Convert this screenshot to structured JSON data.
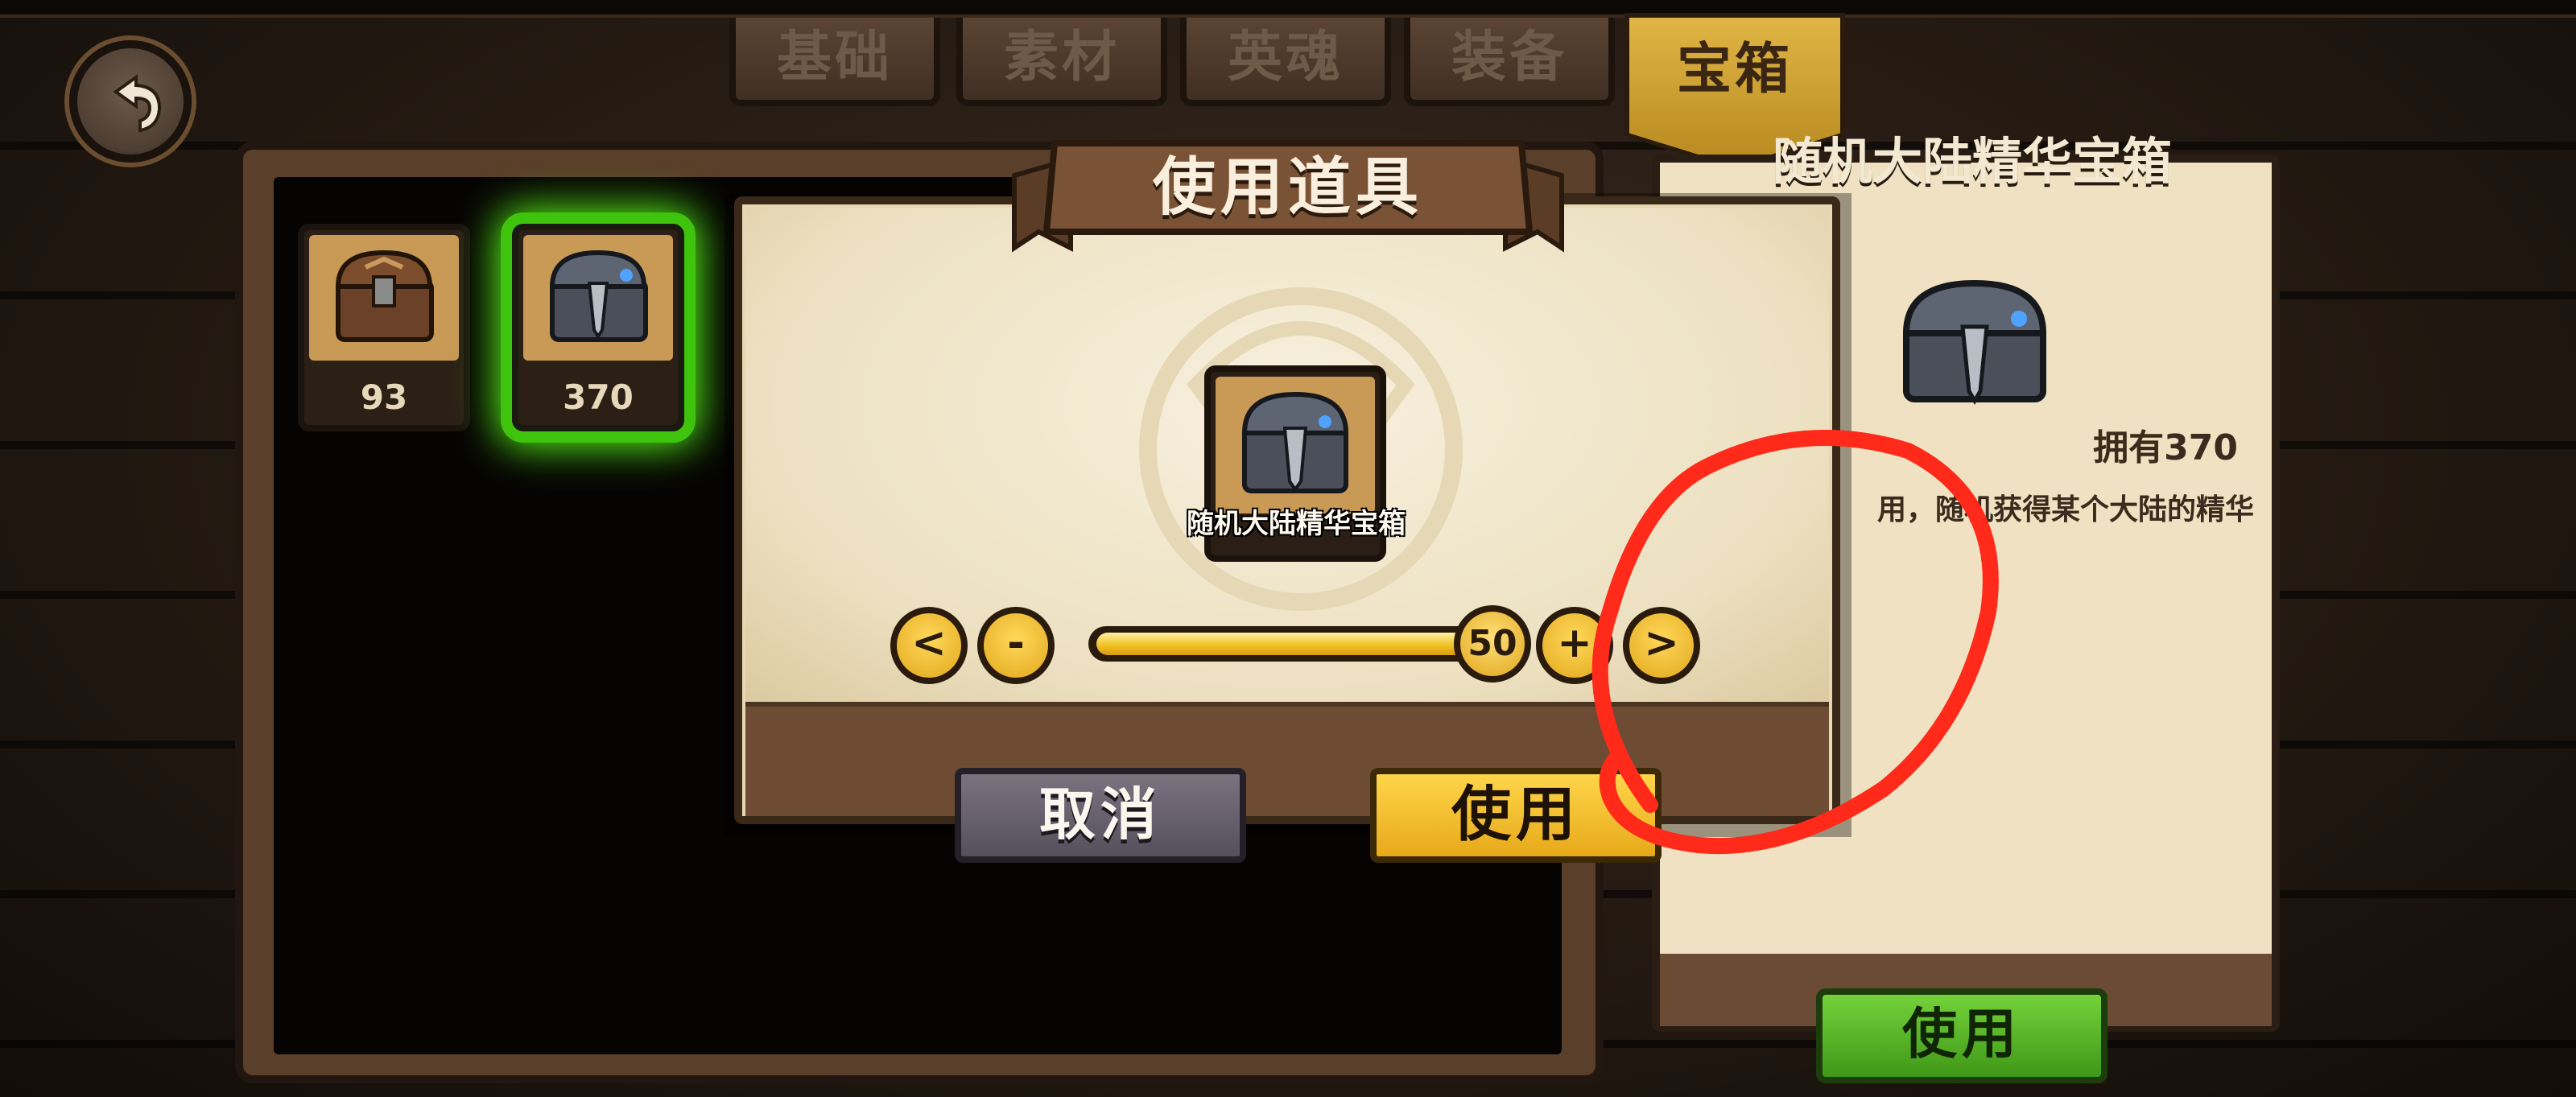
{
  "tabs": [
    {
      "label": "基础"
    },
    {
      "label": "素材"
    },
    {
      "label": "英魂"
    },
    {
      "label": "装备"
    },
    {
      "label": "宝箱"
    }
  ],
  "active_tab": "宝箱",
  "inventory": [
    {
      "count": "93",
      "icon": "brown-chest-icon"
    },
    {
      "count": "370",
      "icon": "iron-chest-icon",
      "selected": true
    }
  ],
  "detail": {
    "title": "随机大陆精华宝箱",
    "owned": "拥有370",
    "description": "用，随机获得某个大陆的精华",
    "use_label": "使用"
  },
  "modal": {
    "title": "使用道具",
    "item_name": "随机大陆精华宝箱",
    "quantity": "50",
    "first_label": "<",
    "minus_label": "-",
    "plus_label": "+",
    "last_label": ">",
    "cancel_label": "取消",
    "use_label": "使用"
  },
  "colors": {
    "accent_gold": "#f2c224",
    "highlight_green": "#58ff1a",
    "annotation_red": "#ff2a1a"
  }
}
